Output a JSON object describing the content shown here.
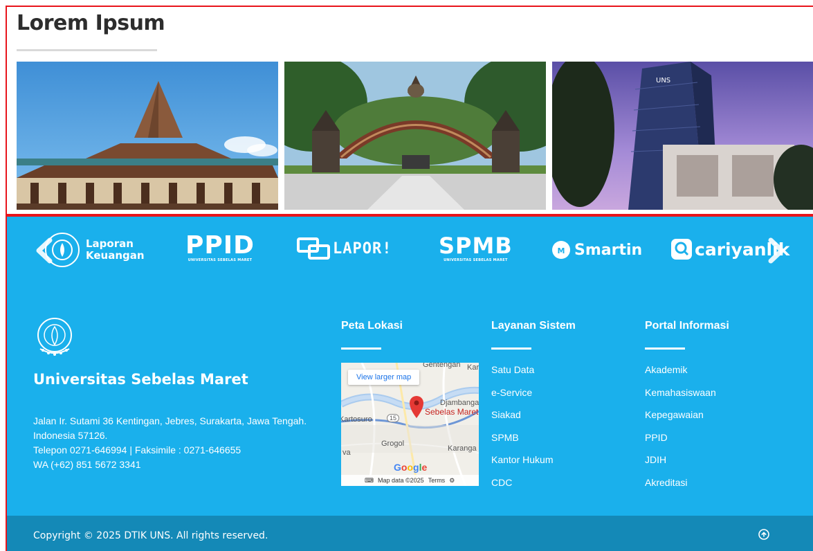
{
  "gallery": {
    "title": "Lorem Ipsum",
    "photos": [
      {
        "icon": "traditional-building-photo"
      },
      {
        "icon": "university-gate-photo"
      },
      {
        "icon": "modern-tower-photo"
      }
    ]
  },
  "partner_logos": {
    "laporan_line1": "Laporan",
    "laporan_line2": "Keuangan",
    "ppid": "PPID",
    "ppid_sub": "UNIVERSITAS SEBELAS MARET",
    "lapor": "LAPOR!",
    "spmb": "SPMB",
    "spmb_sub": "UNIVERSITAS SEBELAS MARET",
    "smartin": "Smartin",
    "cariyanlik": "cariyanlik"
  },
  "university": {
    "name": "Universitas Sebelas Maret",
    "address_line1": "Jalan Ir. Sutami 36 Kentingan, Jebres, Surakarta, Jawa Tengah.",
    "address_line2": "Indonesia 57126.",
    "phone_line": "Telepon 0271-646994 | Faksimile : 0271-646655",
    "wa_line": "WA (+62) 851 5672 3341"
  },
  "map": {
    "title": "Peta Lokasi",
    "button": "View larger map",
    "labels": {
      "gentengan": "Gentengan",
      "kara": "Kara",
      "djambangan": "Djambanga",
      "sebelas_maret": "Sebelas Maret",
      "kartosuro": "Kartosuro",
      "route": "15",
      "grogol": "Grogol",
      "karanga": "Karanga",
      "wa": "va"
    },
    "google": "Google",
    "attribution": "Map data ©2025",
    "terms": "Terms"
  },
  "layanan": {
    "title": "Layanan Sistem",
    "items": [
      "Satu Data",
      "e-Service",
      "Siakad",
      "SPMB",
      "Kantor Hukum",
      "CDC"
    ]
  },
  "portal": {
    "title": "Portal Informasi",
    "items": [
      "Akademik",
      "Kemahasiswaan",
      "Kepegawaian",
      "PPID",
      "JDIH",
      "Akreditasi"
    ]
  },
  "bottom": {
    "copyright": "Copyright © 2025 DTIK UNS. All rights reserved."
  },
  "colors": {
    "footer_bg": "#1ab0ec",
    "bottom_bar": "#1489b7",
    "highlight_border": "#e8141b",
    "map_pin": "#e53935"
  }
}
